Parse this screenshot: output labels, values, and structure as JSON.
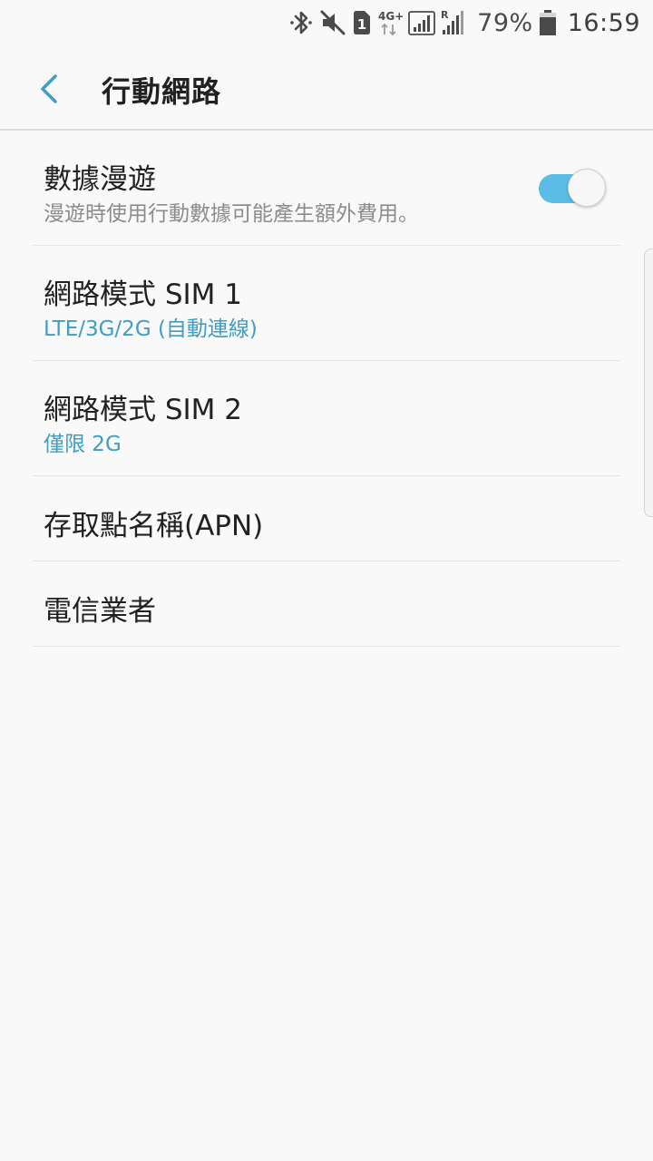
{
  "status_bar": {
    "battery_percent": "79%",
    "time": "16:59",
    "sim_badge": "1",
    "network_type": "4G+",
    "roaming_indicator": "R",
    "icons": [
      "bluetooth-icon",
      "mute-icon",
      "sim-1-icon",
      "4g-plus-icon",
      "signal-icon",
      "roaming-signal-icon",
      "battery-icon"
    ]
  },
  "app_bar": {
    "title": "行動網路"
  },
  "settings": {
    "data_roaming": {
      "title": "數據漫遊",
      "summary": "漫遊時使用行動數據可能產生額外費用。",
      "enabled": true
    },
    "network_mode_sim1": {
      "title": "網路模式 SIM 1",
      "summary": "LTE/3G/2G (自動連線)"
    },
    "network_mode_sim2": {
      "title": "網路模式 SIM 2",
      "summary": "僅限 2G"
    },
    "apn": {
      "title": "存取點名稱(APN)"
    },
    "carriers": {
      "title": "電信業者"
    }
  },
  "colors": {
    "accent": "#3f9ec2",
    "toggle_on": "#5bbde5",
    "background": "#f9f9f9"
  }
}
